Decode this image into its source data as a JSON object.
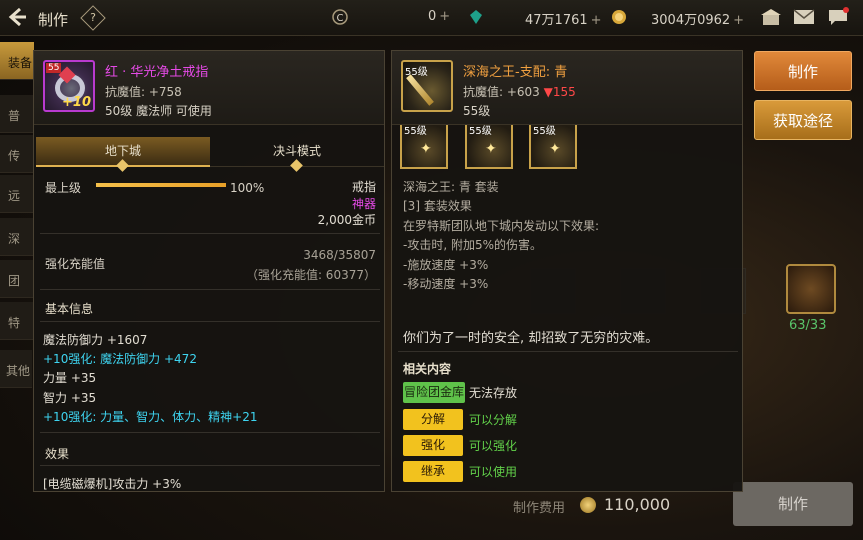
{
  "topbar": {
    "title": "制作",
    "help": "?",
    "cur1": "0",
    "cur2": "47万1761",
    "cur3": "3004万0962",
    "plus": "+"
  },
  "sidebar": [
    "装备",
    "普",
    "传",
    "远",
    "深",
    "团",
    "特",
    "其他"
  ],
  "background": {
    "cost_label": "制作费用",
    "cost_value": "110,000",
    "make_label": "制作",
    "count": "63/33",
    "btn_make": "制作",
    "btn_obtain": "获取途径"
  },
  "left_item": {
    "name": "红 · 华光净土戒指",
    "badge": "55",
    "plus": "+10",
    "resist": "抗魔值: +758",
    "requirement": "50级 魔法师 可使用",
    "tabs": [
      "地下城",
      "决斗模式"
    ],
    "max_level_label": "最上级",
    "max_level_pct": "100%",
    "max_level_value": 1.0,
    "slot": "戒指",
    "rarity": "神器",
    "price": "2,000金币",
    "charge_label": "强化充能值",
    "charge_value": "3468/35807",
    "charge_sub": "（强化充能值: 60377）",
    "basic_title": "基本信息",
    "stats": [
      {
        "text": "魔法防御力 +1607",
        "color": "white"
      },
      {
        "text": "+10强化: 魔法防御力 +472",
        "color": "cyan"
      },
      {
        "text": "力量 +35",
        "color": "white"
      },
      {
        "text": "智力 +35",
        "color": "white"
      },
      {
        "text": "+10强化: 力量、智力、体力、精神+21",
        "color": "cyan"
      }
    ],
    "effect_title": "效果",
    "effect_line": "[电缆磁爆机]攻击力 +3%"
  },
  "right_item": {
    "name": "深海之王-支配: 青",
    "level_badge": "55级",
    "resist": "抗魔值: +603",
    "resist_down": "▼155",
    "level": "55级",
    "mini_levels": [
      "55级",
      "55级",
      "55级"
    ],
    "set_lines": [
      "深海之王: 青  套装",
      "[3] 套装效果",
      "在罗特斯团队地下城内发动以下效果:",
      "-攻击时, 附加5%的伤害。",
      "-施放速度 +3%",
      "-移动速度 +3%"
    ],
    "quote": "你们为了一时的安全, 却招致了无穷的灾难。",
    "related_title": "相关内容",
    "related": [
      {
        "tag": "冒险团金库",
        "desc": "无法存放",
        "tagColor": "green",
        "descColor": "white"
      },
      {
        "tag": "分解",
        "desc": "可以分解",
        "tagColor": "yellow",
        "descColor": "green"
      },
      {
        "tag": "强化",
        "desc": "可以强化",
        "tagColor": "yellow",
        "descColor": "green"
      },
      {
        "tag": "继承",
        "desc": "可以使用",
        "tagColor": "yellow",
        "descColor": "green"
      }
    ]
  },
  "colors": {
    "epic_name": "#e54ae6",
    "legend_name": "#f0a040",
    "cyan_stat": "#3ed4f0",
    "green_text": "#62d24a",
    "accent_gold": "#e0b250"
  }
}
